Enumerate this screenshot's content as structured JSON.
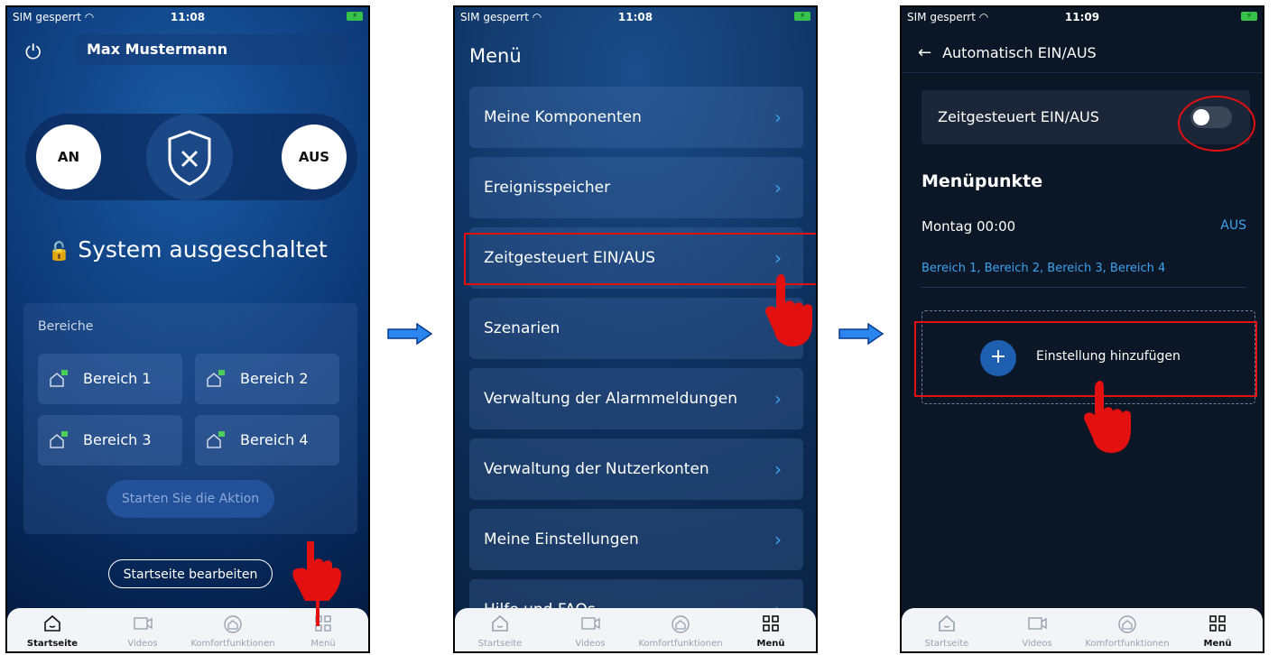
{
  "colors": {
    "accent": "#3aa3f0",
    "annotation": "#e31010",
    "flow_arrow": "#2b86f0"
  },
  "statusbar": {
    "carrier": "SIM gesperrt",
    "time1": "11:08",
    "time2": "11:08",
    "time3": "11:09"
  },
  "home": {
    "user_name": "Max Mustermann",
    "arm_on": "AN",
    "arm_off": "AUS",
    "status": "System ausgeschaltet",
    "areas_title": "Bereiche",
    "areas": [
      "Bereich 1",
      "Bereich 2",
      "Bereich 3",
      "Bereich 4"
    ],
    "start_action": "Starten Sie die Aktion",
    "edit_home": "Startseite bearbeiten"
  },
  "tabs": [
    "Startseite",
    "Videos",
    "Komfortfunktionen",
    "Menü"
  ],
  "menu": {
    "title": "Menü",
    "items": [
      "Meine Komponenten",
      "Ereignisspeicher",
      "Zeitgesteuert EIN/AUS",
      "Szenarien",
      "Verwaltung der Alarmmeldungen",
      "Verwaltung der Nutzerkonten",
      "Meine Einstellungen",
      "Hilfe und FAQs"
    ]
  },
  "auto": {
    "title": "Automatisch EIN/AUS",
    "toggle_label": "Zeitgesteuert EIN/AUS",
    "section": "Menüpunkte",
    "schedule_time": "Montag 00:00",
    "schedule_status": "AUS",
    "schedule_areas": "Bereich 1, Bereich 2, Bereich 3, Bereich 4",
    "add_label": "Einstellung hinzufügen"
  }
}
